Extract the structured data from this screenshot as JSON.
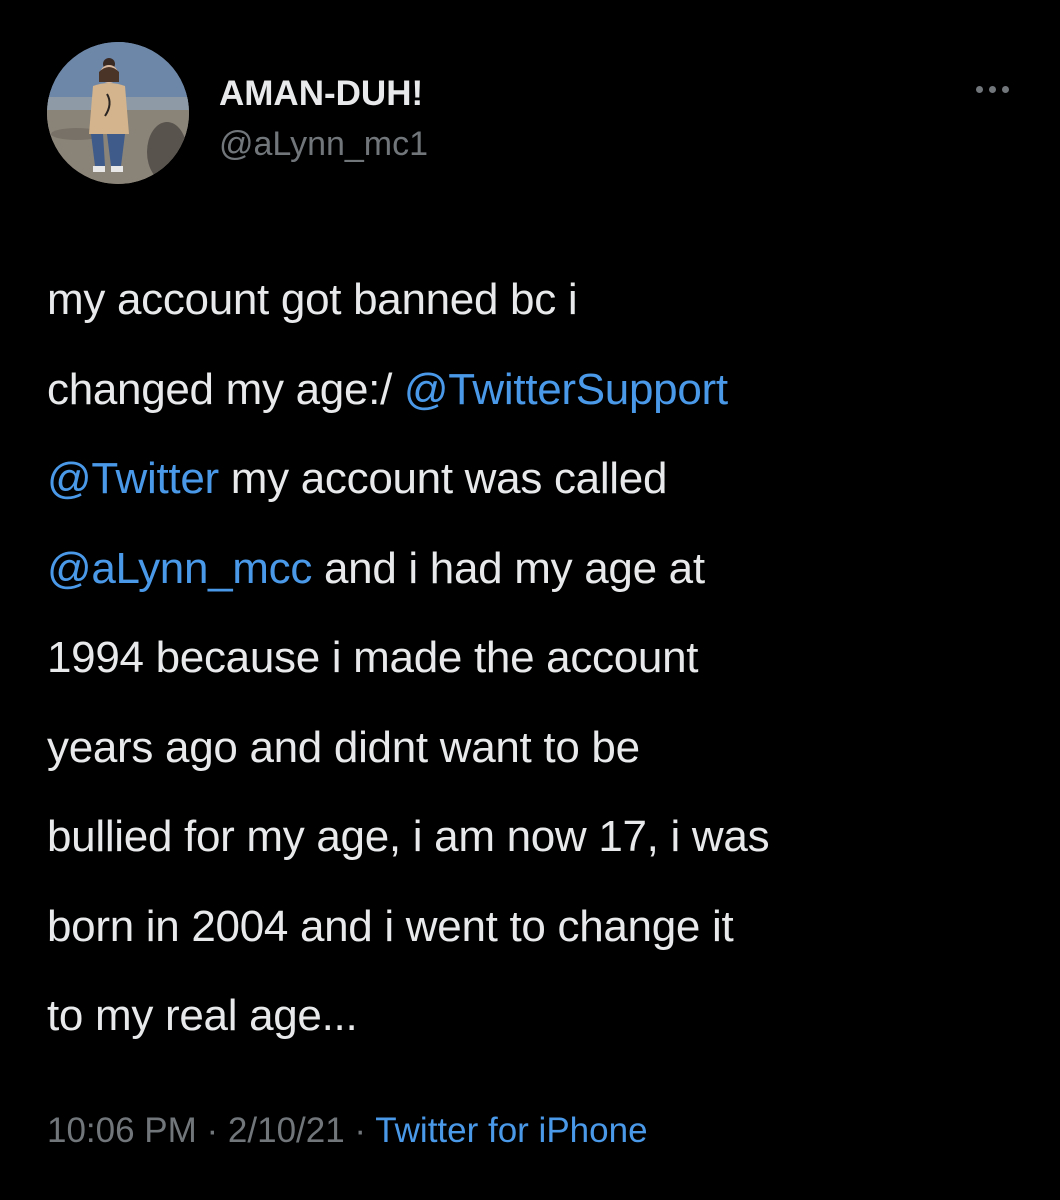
{
  "author": {
    "display_name": "AMAN-DUH!",
    "handle": "@aLynn_mc1"
  },
  "tweet": {
    "lines": [
      [
        {
          "text": "my account got banned bc i",
          "mention": false
        }
      ],
      [
        {
          "text": "changed my age:/ ",
          "mention": false
        },
        {
          "text": "@TwitterSupport",
          "mention": true
        }
      ],
      [
        {
          "text": "@Twitter",
          "mention": true
        },
        {
          "text": " my account was called",
          "mention": false
        }
      ],
      [
        {
          "text": "@aLynn_mcc",
          "mention": true
        },
        {
          "text": " and i had my age at",
          "mention": false
        }
      ],
      [
        {
          "text": "1994 because i made the account",
          "mention": false
        }
      ],
      [
        {
          "text": "years ago and didnt want to be",
          "mention": false
        }
      ],
      [
        {
          "text": "bullied for my age, i am now 17, i was",
          "mention": false
        }
      ],
      [
        {
          "text": "born in 2004 and i went to change it",
          "mention": false
        }
      ],
      [
        {
          "text": "to my real age...",
          "mention": false
        }
      ]
    ]
  },
  "meta": {
    "time": "10:06 PM",
    "separator": " · ",
    "date": "2/10/21",
    "source": "Twitter for iPhone"
  },
  "icons": {
    "more": "more-horizontal-icon"
  },
  "colors": {
    "background": "#000000",
    "text": "#e7e9ea",
    "secondary": "#71767b",
    "link": "#4a99e9"
  }
}
